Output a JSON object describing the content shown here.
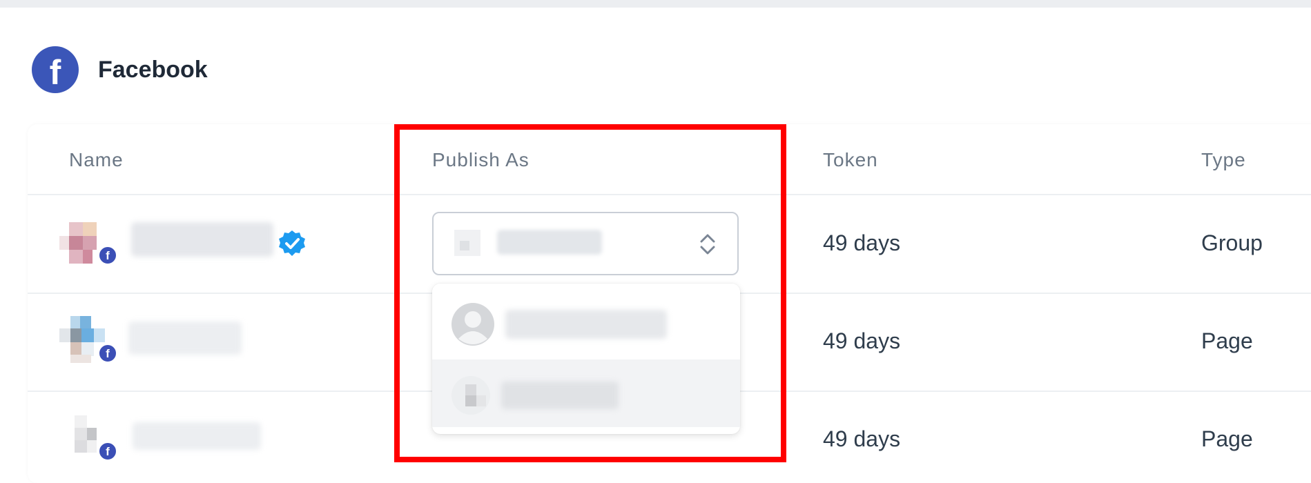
{
  "header": {
    "logo_letter": "f",
    "title": "Facebook"
  },
  "table": {
    "columns": [
      "Name",
      "Publish As",
      "Token",
      "Type"
    ],
    "rows": [
      {
        "name": "",
        "verified": true,
        "token": "49 days",
        "type": "Group"
      },
      {
        "name": "",
        "verified": false,
        "token": "49 days",
        "type": "Page"
      },
      {
        "name": "",
        "verified": false,
        "token": "49 days",
        "type": "Page"
      }
    ]
  },
  "publish_as": {
    "selected": "",
    "options": [
      {
        "label": "",
        "avatar": "default-user-icon"
      },
      {
        "label": "",
        "avatar": "page-avatar"
      }
    ]
  },
  "badge_letter": "f",
  "colors": {
    "facebook_blue": "#3b56b8",
    "verified_blue": "#1d9bf0",
    "highlight_red": "#ff0000",
    "header_text": "#6b7785",
    "cell_text": "#2f3d4c"
  },
  "icons": [
    "facebook-logo-icon",
    "facebook-badge-icon",
    "verified-icon",
    "chevron-up-down-icon",
    "default-user-icon"
  ]
}
